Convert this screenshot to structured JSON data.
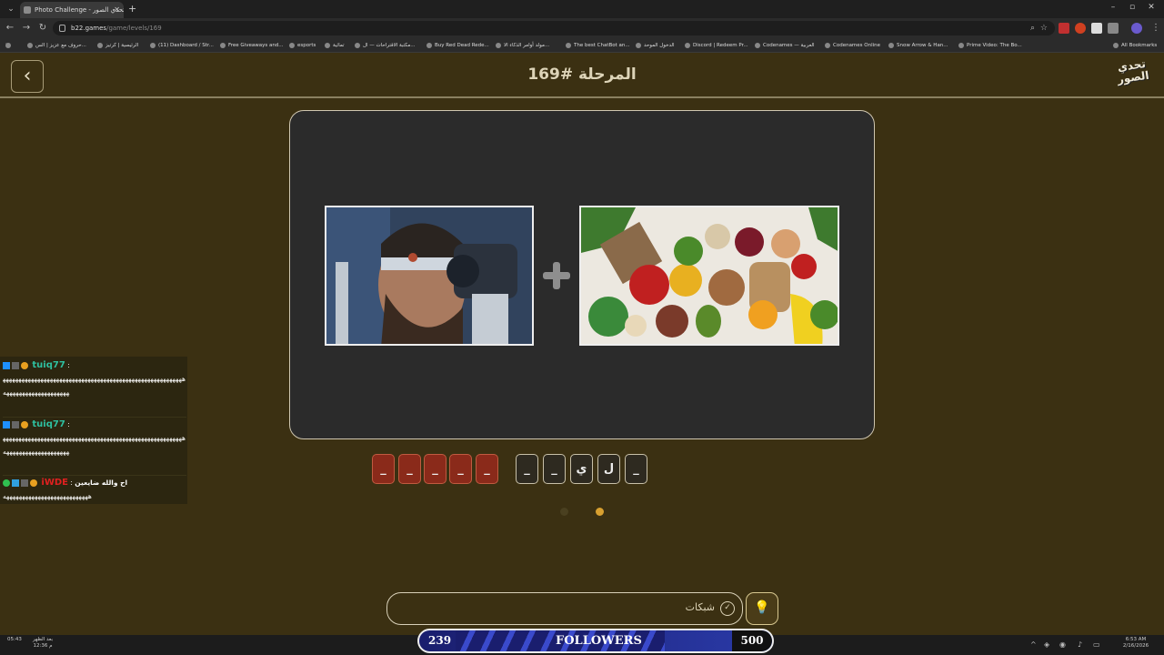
{
  "browser": {
    "tab_title": "Photo Challenge - تحدي الصور",
    "tab_close": "✕",
    "new_tab": "+",
    "url_host": "b22.games",
    "url_path": "/game/levels/169",
    "bookmarks": [
      "حروف مع عزيز | الس...",
      "الرئيسية | كرتيز",
      "(11) Dashboard / Str...",
      "Free Giveaways and...",
      "esports",
      "تماثية",
      "مكتبة الاقتراحات — ال...",
      "Buy Red Dead Rede...",
      "مولد أوامر الذكاء الا...",
      "The best ChatBot an...",
      "الدخول الموحد",
      "Discord | Redeem Pr...",
      "Codenames — العربية",
      "Codenames Online",
      "Snow Arrow & Han...",
      "Prime Video: The Bo...",
      "All Bookmarks"
    ]
  },
  "game": {
    "back_icon": "‹",
    "level_title": "المرحلة #169",
    "logo_text": "تحدي الصور",
    "plus": "+",
    "slots_word1": [
      "_",
      "_",
      "_",
      "_",
      "_"
    ],
    "slots_word2": [
      "_",
      "_",
      "ي",
      "ل",
      "_"
    ],
    "hint_label": "شبكات",
    "bulb_icon": "💡"
  },
  "chat": [
    {
      "user": "tuiq77",
      "sep": ":",
      "text": "ههههههههههههههههههههههههههههههههههههههههههههههههههههههههههههههههههههههههههههههه"
    },
    {
      "user": "tuiq77",
      "sep": ":",
      "text": "ههههههههههههههههههههههههههههههههههههههههههههههههههههههههههههههههههههههههههههههه"
    },
    {
      "user": "iWDE",
      "sep": ":",
      "prefix": "اح والله ضايعين",
      "text": "هههههههههههههههههههههههههههه"
    }
  ],
  "overlay": {
    "followers_count": "239",
    "followers_label": "FOLLOWERS",
    "followers_goal": "500"
  },
  "taskbar": {
    "left_date_top": "بعد الظهر",
    "left_date_bottom": "12:36 م",
    "left_side": "05:43",
    "clock_time": "6:53 AM",
    "clock_date": "2/16/2026"
  },
  "colors": {
    "background": "#3b3012",
    "puzzle_panel": "#2b2b2b",
    "slot_red": "#8a2a1a",
    "accent_gold": "#d8a030"
  }
}
